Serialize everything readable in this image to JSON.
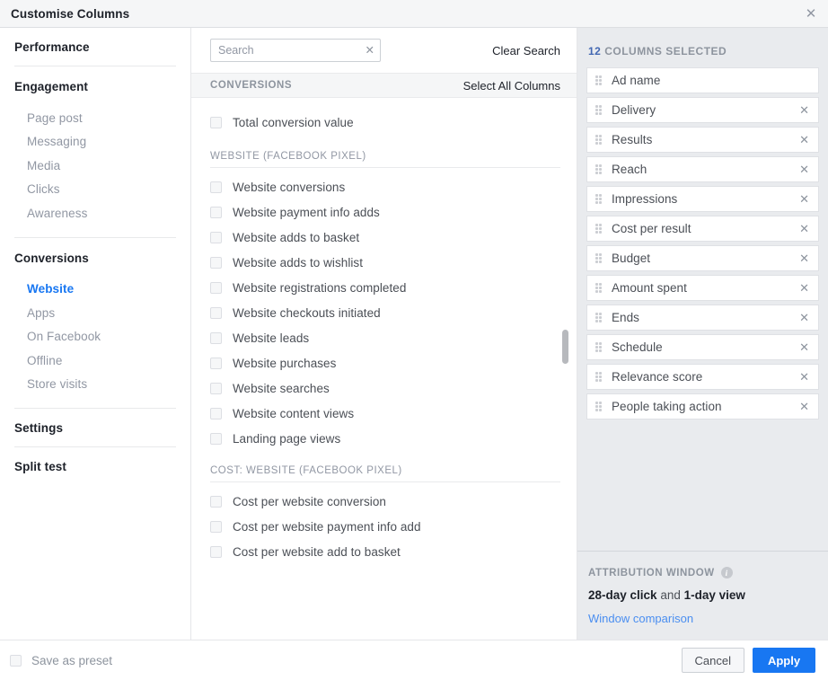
{
  "dialog": {
    "title": "Customise Columns",
    "close_icon": "close-icon"
  },
  "sidebar": {
    "groups": [
      {
        "heading": "Performance",
        "items": []
      },
      {
        "heading": "Engagement",
        "items": [
          "Page post",
          "Messaging",
          "Media",
          "Clicks",
          "Awareness"
        ]
      },
      {
        "heading": "Conversions",
        "items": [
          "Website",
          "Apps",
          "On Facebook",
          "Offline",
          "Store visits"
        ],
        "active": "Website"
      },
      {
        "heading": "Settings",
        "items": []
      },
      {
        "heading": "Split test",
        "items": []
      }
    ]
  },
  "search": {
    "value": "",
    "placeholder": "Search",
    "clear_icon": "close-icon",
    "clear_search_label": "Clear Search"
  },
  "section": {
    "title": "CONVERSIONS",
    "select_all_label": "Select All Columns"
  },
  "options": {
    "top": [
      {
        "label": "Total conversion value",
        "checked": false
      }
    ],
    "groups": [
      {
        "label": "WEBSITE (FACEBOOK PIXEL)",
        "items": [
          {
            "label": "Website conversions",
            "checked": false
          },
          {
            "label": "Website payment info adds",
            "checked": false
          },
          {
            "label": "Website adds to basket",
            "checked": false
          },
          {
            "label": "Website adds to wishlist",
            "checked": false
          },
          {
            "label": "Website registrations completed",
            "checked": false
          },
          {
            "label": "Website checkouts initiated",
            "checked": false
          },
          {
            "label": "Website leads",
            "checked": false
          },
          {
            "label": "Website purchases",
            "checked": false
          },
          {
            "label": "Website searches",
            "checked": false
          },
          {
            "label": "Website content views",
            "checked": false
          },
          {
            "label": "Landing page views",
            "checked": false
          }
        ]
      },
      {
        "label": "COST: WEBSITE (FACEBOOK PIXEL)",
        "items": [
          {
            "label": "Cost per website conversion",
            "checked": false
          },
          {
            "label": "Cost per website payment info add",
            "checked": false
          },
          {
            "label": "Cost per website add to basket",
            "checked": false
          }
        ]
      }
    ]
  },
  "selected_panel": {
    "count": "12",
    "heading_suffix": "COLUMNS SELECTED",
    "columns": [
      {
        "label": "Ad name",
        "removable": false
      },
      {
        "label": "Delivery",
        "removable": true
      },
      {
        "label": "Results",
        "removable": true
      },
      {
        "label": "Reach",
        "removable": true
      },
      {
        "label": "Impressions",
        "removable": true
      },
      {
        "label": "Cost per result",
        "removable": true
      },
      {
        "label": "Budget",
        "removable": true
      },
      {
        "label": "Amount spent",
        "removable": true
      },
      {
        "label": "Ends",
        "removable": true
      },
      {
        "label": "Schedule",
        "removable": true
      },
      {
        "label": "Relevance score",
        "removable": true
      },
      {
        "label": "People taking action",
        "removable": true
      }
    ]
  },
  "attribution": {
    "heading": "ATTRIBUTION WINDOW",
    "info_icon": "info-icon",
    "click_window": "28-day click",
    "conjunction": " and ",
    "view_window": "1-day view",
    "link": "Window comparison"
  },
  "footer": {
    "save_preset_label": "Save as preset",
    "cancel_label": "Cancel",
    "apply_label": "Apply"
  },
  "colors": {
    "accent": "#1877f2",
    "panel_bg": "#e9ebee",
    "count_blue": "#4267b2",
    "link_blue": "#4a8ef0"
  }
}
